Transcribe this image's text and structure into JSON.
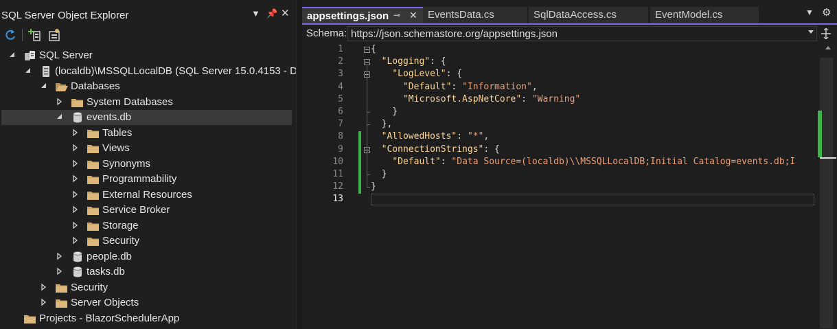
{
  "object_explorer": {
    "title": "SQL Server Object Explorer",
    "title_buttons": [
      "chevron-down-icon",
      "pin-icon",
      "close-icon"
    ],
    "toolbar": [
      "refresh-icon",
      "add-server-icon",
      "filter-settings-icon"
    ],
    "tree": [
      {
        "label": "SQL Server",
        "level": 0,
        "expanded": true,
        "icon": "sql-server-icon"
      },
      {
        "label": "(localdb)\\MSSQLLocalDB (SQL Server 15.0.4153 - D",
        "level": 1,
        "expanded": true,
        "icon": "server-icon"
      },
      {
        "label": "Databases",
        "level": 2,
        "expanded": true,
        "icon": "folder-open-icon"
      },
      {
        "label": "System Databases",
        "level": 3,
        "expanded": false,
        "icon": "folder-icon"
      },
      {
        "label": "events.db",
        "level": 3,
        "expanded": true,
        "icon": "database-icon",
        "selected": true
      },
      {
        "label": "Tables",
        "level": 4,
        "expanded": false,
        "icon": "folder-icon"
      },
      {
        "label": "Views",
        "level": 4,
        "expanded": false,
        "icon": "folder-icon"
      },
      {
        "label": "Synonyms",
        "level": 4,
        "expanded": false,
        "icon": "folder-icon"
      },
      {
        "label": "Programmability",
        "level": 4,
        "expanded": false,
        "icon": "folder-icon"
      },
      {
        "label": "External Resources",
        "level": 4,
        "expanded": false,
        "icon": "folder-icon"
      },
      {
        "label": "Service Broker",
        "level": 4,
        "expanded": false,
        "icon": "folder-icon"
      },
      {
        "label": "Storage",
        "level": 4,
        "expanded": false,
        "icon": "folder-icon"
      },
      {
        "label": "Security",
        "level": 4,
        "expanded": false,
        "icon": "folder-icon"
      },
      {
        "label": "people.db",
        "level": 3,
        "expanded": false,
        "icon": "database-icon"
      },
      {
        "label": "tasks.db",
        "level": 3,
        "expanded": false,
        "icon": "database-icon"
      },
      {
        "label": "Security",
        "level": 2,
        "expanded": false,
        "icon": "folder-icon"
      },
      {
        "label": "Server Objects",
        "level": 2,
        "expanded": false,
        "icon": "folder-icon"
      },
      {
        "label": "Projects - BlazorSchedulerApp",
        "level": 0,
        "expanded": null,
        "icon": "folder-icon"
      }
    ]
  },
  "editor": {
    "tabs": [
      {
        "label": "appsettings.json",
        "active": true
      },
      {
        "label": "EventsData.cs",
        "active": false
      },
      {
        "label": "SqlDataAccess.cs",
        "active": false
      },
      {
        "label": "EventModel.cs",
        "active": false
      }
    ],
    "schema_label": "Schema:",
    "schema_url": "https://json.schemastore.org/appsettings.json",
    "line_numbers": [
      "1",
      "2",
      "3",
      "4",
      "5",
      "6",
      "7",
      "8",
      "9",
      "10",
      "11",
      "12",
      "13"
    ],
    "current_line": 13,
    "code_lines": [
      [
        {
          "t": "{",
          "c": "p"
        }
      ],
      [
        {
          "t": "  ",
          "c": "p"
        },
        {
          "t": "\"Logging\"",
          "c": "k"
        },
        {
          "t": ": {",
          "c": "p"
        }
      ],
      [
        {
          "t": "    ",
          "c": "p"
        },
        {
          "t": "\"LogLevel\"",
          "c": "k"
        },
        {
          "t": ": {",
          "c": "p"
        }
      ],
      [
        {
          "t": "      ",
          "c": "p"
        },
        {
          "t": "\"Default\"",
          "c": "k"
        },
        {
          "t": ": ",
          "c": "p"
        },
        {
          "t": "\"Information\"",
          "c": "s"
        },
        {
          "t": ",",
          "c": "p"
        }
      ],
      [
        {
          "t": "      ",
          "c": "p"
        },
        {
          "t": "\"Microsoft.AspNetCore\"",
          "c": "k"
        },
        {
          "t": ": ",
          "c": "p"
        },
        {
          "t": "\"Warning\"",
          "c": "s"
        }
      ],
      [
        {
          "t": "    }",
          "c": "p"
        }
      ],
      [
        {
          "t": "  },",
          "c": "p"
        }
      ],
      [
        {
          "t": "  ",
          "c": "p"
        },
        {
          "t": "\"AllowedHosts\"",
          "c": "k"
        },
        {
          "t": ": ",
          "c": "p"
        },
        {
          "t": "\"*\"",
          "c": "s"
        },
        {
          "t": ",",
          "c": "p"
        }
      ],
      [
        {
          "t": "  ",
          "c": "p"
        },
        {
          "t": "\"ConnectionStrings\"",
          "c": "k"
        },
        {
          "t": ": {",
          "c": "p"
        }
      ],
      [
        {
          "t": "    ",
          "c": "p"
        },
        {
          "t": "\"Default\"",
          "c": "k"
        },
        {
          "t": ": ",
          "c": "p"
        },
        {
          "t": "\"Data Source=(localdb)\\\\MSSQLLocalDB;Initial Catalog=events.db;I",
          "c": "s"
        }
      ],
      [
        {
          "t": "  }",
          "c": "p"
        }
      ],
      [
        {
          "t": "}",
          "c": "p"
        }
      ],
      []
    ]
  },
  "colors": {
    "accent": "#7b68ee",
    "change_marker": "#3fb24a",
    "json_key": "#fdd59a",
    "json_string": "#e8a07b",
    "folder": "#dcb67a"
  }
}
